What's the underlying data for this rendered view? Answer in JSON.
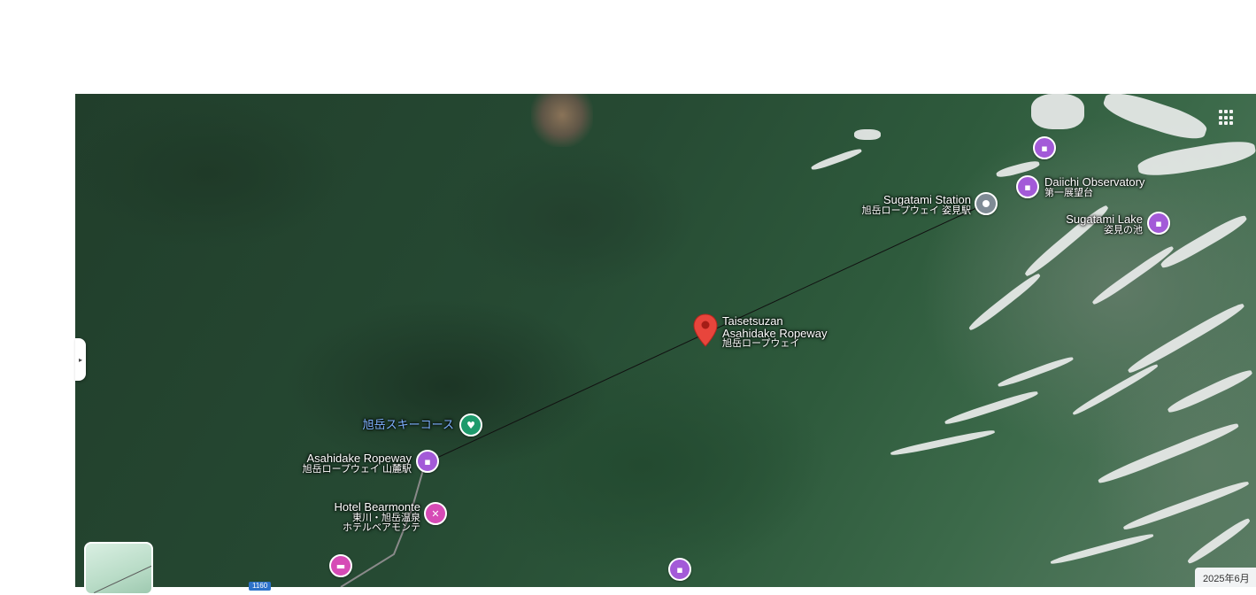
{
  "map": {
    "view": "satellite",
    "places": [
      {
        "id": "daiichi",
        "name": "Daiichi Observatory",
        "sub": "第一展望台",
        "icon": "landmark-icon",
        "color": "#a35ad8"
      },
      {
        "id": "sugatami-station",
        "name": "Sugatami Station",
        "sub": "旭岳ロープウェイ 姿見駅",
        "icon": "transit-station-icon",
        "color": "#7f8b95"
      },
      {
        "id": "sugatami-lake",
        "name": "Sugatami Lake",
        "sub": "姿見の池",
        "icon": "landmark-icon",
        "color": "#a35ad8"
      },
      {
        "id": "selected",
        "name_line1": "Taisetsuzan",
        "name_line2": "Asahidake Ropeway",
        "sub": "旭岳ロープウェイ",
        "icon": "red-location-pin-icon",
        "color": "#e8453c"
      },
      {
        "id": "ski",
        "name": "旭岳スキーコース",
        "icon": "ski-area-icon",
        "color": "#1e9a6c"
      },
      {
        "id": "ropeway-base",
        "name": "Asahidake Ropeway",
        "sub": "旭岳ロープウェイ 山麓駅",
        "icon": "landmark-icon",
        "color": "#a35ad8"
      },
      {
        "id": "hotel",
        "name": "Hotel Bearmonte",
        "sub_line1": "東川・旭岳温泉",
        "sub_line2": "ホテルベアモンテ",
        "icon": "hotel-icon",
        "color": "#d64bb6"
      }
    ],
    "road_number": "1160",
    "imagery_date": "2025年6月"
  },
  "controls": {
    "apps_icon": "apps-grid-icon",
    "collapse_icon": "collapse-panel-icon",
    "layers_icon": "layers-thumbnail"
  }
}
